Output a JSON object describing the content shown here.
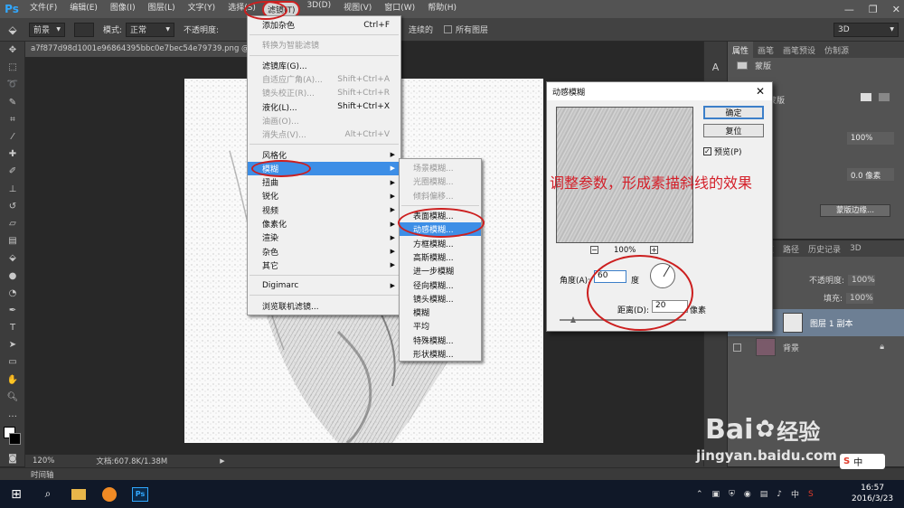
{
  "app": {
    "logo": "Ps"
  },
  "menubar": {
    "items": [
      "文件(F)",
      "编辑(E)",
      "图像(I)",
      "图层(L)",
      "文字(Y)",
      "选择(S)",
      "滤镜(T)",
      "3D(D)",
      "视图(V)",
      "窗口(W)",
      "帮助(H)"
    ],
    "active_index": 6
  },
  "options_bar": {
    "preset": "前景",
    "mode_label": "模式:",
    "mode_value": "正常",
    "opacity_label": "不透明度:",
    "contiguous_label": "连续的",
    "all_layers_label": "所有图层",
    "workspace": "3D"
  },
  "document": {
    "tab_title": "a7f877d98d1001e96864395bbc0e7bec54e79739.png @ 12",
    "zoom": "120%",
    "doc_info": "文档:607.8K/1.38M",
    "timeline_label": "时间轴"
  },
  "filter_menu": {
    "items": [
      {
        "label": "添加杂色",
        "shortcut": "Ctrl+F",
        "disabled": false,
        "submenu": false
      },
      {
        "sep": true
      },
      {
        "label": "转换为智能滤镜",
        "shortcut": "",
        "disabled": true,
        "submenu": false
      },
      {
        "sep": true
      },
      {
        "label": "滤镜库(G)...",
        "shortcut": "",
        "disabled": false,
        "submenu": false
      },
      {
        "label": "自适应广角(A)...",
        "shortcut": "Shift+Ctrl+A",
        "disabled": true,
        "submenu": false
      },
      {
        "label": "镜头校正(R)...",
        "shortcut": "Shift+Ctrl+R",
        "disabled": true,
        "submenu": false
      },
      {
        "label": "液化(L)...",
        "shortcut": "Shift+Ctrl+X",
        "disabled": false,
        "submenu": false
      },
      {
        "label": "油画(O)...",
        "shortcut": "",
        "disabled": true,
        "submenu": false
      },
      {
        "label": "消失点(V)...",
        "shortcut": "Alt+Ctrl+V",
        "disabled": true,
        "submenu": false
      },
      {
        "sep": true
      },
      {
        "label": "风格化",
        "shortcut": "",
        "disabled": false,
        "submenu": true
      },
      {
        "label": "模糊",
        "shortcut": "",
        "disabled": false,
        "submenu": true,
        "highlighted": true
      },
      {
        "label": "扭曲",
        "shortcut": "",
        "disabled": false,
        "submenu": true
      },
      {
        "label": "锐化",
        "shortcut": "",
        "disabled": false,
        "submenu": true
      },
      {
        "label": "视频",
        "shortcut": "",
        "disabled": false,
        "submenu": true
      },
      {
        "label": "像素化",
        "shortcut": "",
        "disabled": false,
        "submenu": true
      },
      {
        "label": "渲染",
        "shortcut": "",
        "disabled": false,
        "submenu": true
      },
      {
        "label": "杂色",
        "shortcut": "",
        "disabled": false,
        "submenu": true
      },
      {
        "label": "其它",
        "shortcut": "",
        "disabled": false,
        "submenu": true
      },
      {
        "sep": true
      },
      {
        "label": "Digimarc",
        "shortcut": "",
        "disabled": false,
        "submenu": true
      },
      {
        "sep": true
      },
      {
        "label": "浏览联机滤镜...",
        "shortcut": "",
        "disabled": false,
        "submenu": false
      }
    ]
  },
  "blur_submenu": {
    "items": [
      {
        "label": "场景模糊...",
        "disabled": true
      },
      {
        "label": "光圈模糊...",
        "disabled": true
      },
      {
        "label": "倾斜偏移...",
        "disabled": true
      },
      {
        "sep": true
      },
      {
        "label": "表面模糊...",
        "disabled": false
      },
      {
        "label": "动感模糊...",
        "disabled": false,
        "highlighted": true
      },
      {
        "label": "方框模糊...",
        "disabled": false
      },
      {
        "label": "高斯模糊...",
        "disabled": false
      },
      {
        "label": "进一步模糊",
        "disabled": false
      },
      {
        "label": "径向模糊...",
        "disabled": false
      },
      {
        "label": "镜头模糊...",
        "disabled": false
      },
      {
        "label": "模糊",
        "disabled": false
      },
      {
        "label": "平均",
        "disabled": false
      },
      {
        "label": "特殊模糊...",
        "disabled": false
      },
      {
        "label": "形状模糊...",
        "disabled": false
      }
    ]
  },
  "dialog": {
    "title": "动感模糊",
    "ok_label": "确定",
    "reset_label": "复位",
    "preview_label": "预览(P)",
    "preview_checked": true,
    "zoom": "100%",
    "zoom_minus": "−",
    "zoom_plus": "+",
    "angle_label": "角度(A):",
    "angle_value": "60",
    "angle_unit": "度",
    "distance_label": "距离(D):",
    "distance_value": "20",
    "distance_unit": "像素"
  },
  "annotation": {
    "note": "调整参数，形成素描斜线的效果"
  },
  "properties_panel": {
    "tabs": [
      "属性",
      "画笔",
      "画笔预设",
      "仿制源"
    ],
    "mask_label": "蒙版",
    "mask_name": "蒙版",
    "density_value": "100%",
    "feather_value": "0.0 像素",
    "mask_edge_button": "蒙版边缘..."
  },
  "layers_panel": {
    "tabs": [
      "图层",
      "通道",
      "路径",
      "历史记录",
      "3D"
    ],
    "opacity_label": "不透明度:",
    "opacity_value": "100%",
    "fill_label": "填充:",
    "fill_value": "100%",
    "layers": [
      {
        "name": "图层 1 副本",
        "selected": true
      },
      {
        "name": "背景",
        "selected": false,
        "locked": true
      }
    ]
  },
  "taskbar": {
    "time": "16:57",
    "date": "2016/3/23",
    "ime": "中",
    "ps_label": "Ps"
  },
  "watermark": {
    "brand": "Bai",
    "brand_cn": "经验",
    "url": "jingyan.baidu.com",
    "ime_badge": "中"
  }
}
